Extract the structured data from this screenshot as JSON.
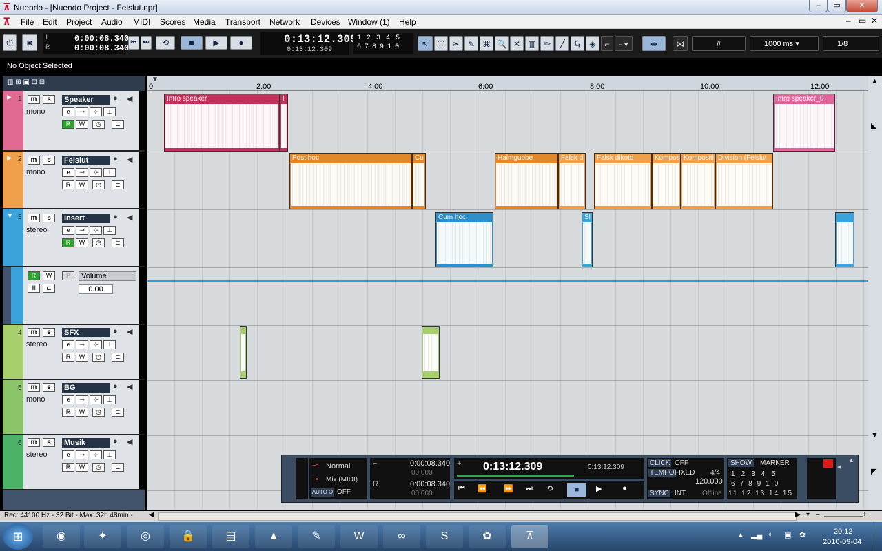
{
  "window": {
    "title": "Nuendo - [Nuendo Project - Felslut.npr]"
  },
  "menu": [
    "File",
    "Edit",
    "Project",
    "Audio",
    "MIDI",
    "Scores",
    "Media",
    "Transport",
    "Network",
    "Devices",
    "Window (1)",
    "Help"
  ],
  "toolbar": {
    "time_left": "0:00:08.340",
    "time_right": "0:00:08.340",
    "main_time": "0:13:12.309",
    "main_time_sub": "0:13:12.309",
    "markers_row1": [
      "1",
      "2",
      "3",
      "4",
      "5"
    ],
    "markers_row2": [
      "6",
      "7",
      "8",
      "9",
      "10"
    ],
    "snap_value": "-",
    "quantize_value": "1000 ms",
    "grid_value": "1/8"
  },
  "info_line": "No Object Selected",
  "ruler": {
    "labels": [
      "0",
      "2:00",
      "4:00",
      "6:00",
      "8:00",
      "10:00",
      "12:00"
    ]
  },
  "tracks": [
    {
      "num": "1",
      "name": "Speaker",
      "channels": "mono",
      "color": "#e06a92"
    },
    {
      "num": "2",
      "name": "Felslut",
      "channels": "mono",
      "color": "#f0a04a"
    },
    {
      "num": "3",
      "name": "Insert",
      "channels": "stereo",
      "color": "#3aa3dc"
    },
    {
      "num": "4",
      "name": "SFX",
      "channels": "stereo",
      "color": "#a7cf6e"
    },
    {
      "num": "5",
      "name": "BG",
      "channels": "mono",
      "color": "#8cc46a"
    },
    {
      "num": "6",
      "name": "Musik",
      "channels": "stereo",
      "color": "#4bb268"
    }
  ],
  "automation": {
    "param": "Volume",
    "value": "0.00"
  },
  "events": [
    {
      "track": 1,
      "title": "Intro speaker",
      "color": "#c3305e"
    },
    {
      "track": 1,
      "title": "I",
      "color": "#c3305e"
    },
    {
      "track": 1,
      "title": "Intro speaker_0",
      "color": "#e0659a"
    },
    {
      "track": 2,
      "title": "Post hoc",
      "color": "#e0882a"
    },
    {
      "track": 2,
      "title": "Cu",
      "color": "#e0882a"
    },
    {
      "track": 2,
      "title": "Halmgubbe",
      "color": "#e0882a"
    },
    {
      "track": 2,
      "title": "Falsk d",
      "color": "#f0a04a"
    },
    {
      "track": 2,
      "title": "Falsk dikoto",
      "color": "#f0a04a"
    },
    {
      "track": 2,
      "title": "Kompos",
      "color": "#f0a04a"
    },
    {
      "track": 2,
      "title": "Kompositi",
      "color": "#f0a04a"
    },
    {
      "track": 2,
      "title": "Division (Felslut",
      "color": "#f0a04a"
    },
    {
      "track": 3,
      "title": "Cum hoc",
      "color": "#2e8ec9"
    },
    {
      "track": 3,
      "title": "Sl",
      "color": "#3aa3dc"
    },
    {
      "track": 3,
      "title": "",
      "color": "#3aa3dc"
    },
    {
      "track": 4,
      "title": "",
      "color": "#a7cf6e"
    },
    {
      "track": 4,
      "title": "",
      "color": "#a7cf6e"
    }
  ],
  "transport": {
    "mode": "Normal",
    "mix": "Mix (MIDI)",
    "auto_q": "AUTO Q",
    "auto_q_state": "OFF",
    "left_locator": "0:00:08.340",
    "left_sub": "00.000",
    "right_locator": "0:00:08.340",
    "right_sub": "00.000",
    "main_time": "0:13:12.309",
    "main_sub": "0:13:12.309",
    "click_label": "CLICK",
    "click": "OFF",
    "tempo_label": "TEMPO",
    "tempo_mode": "FIXED",
    "signature": "4/4",
    "tempo": "120.000",
    "sync_label": "SYNC",
    "sync": "INT.",
    "sync_state": "Offline",
    "show": "SHOW",
    "marker": "MARKER",
    "marker_row1": [
      "1",
      "2",
      "3",
      "4",
      "5"
    ],
    "marker_row2": [
      "6",
      "7",
      "8",
      "9",
      "10"
    ],
    "marker_row3": [
      "11",
      "12",
      "13",
      "14",
      "15"
    ]
  },
  "status_bar": "Rec: 44100 Hz - 32 Bit - Max: 32h 48min -",
  "taskbar": {
    "time": "20:12",
    "date": "2010-09-04"
  }
}
